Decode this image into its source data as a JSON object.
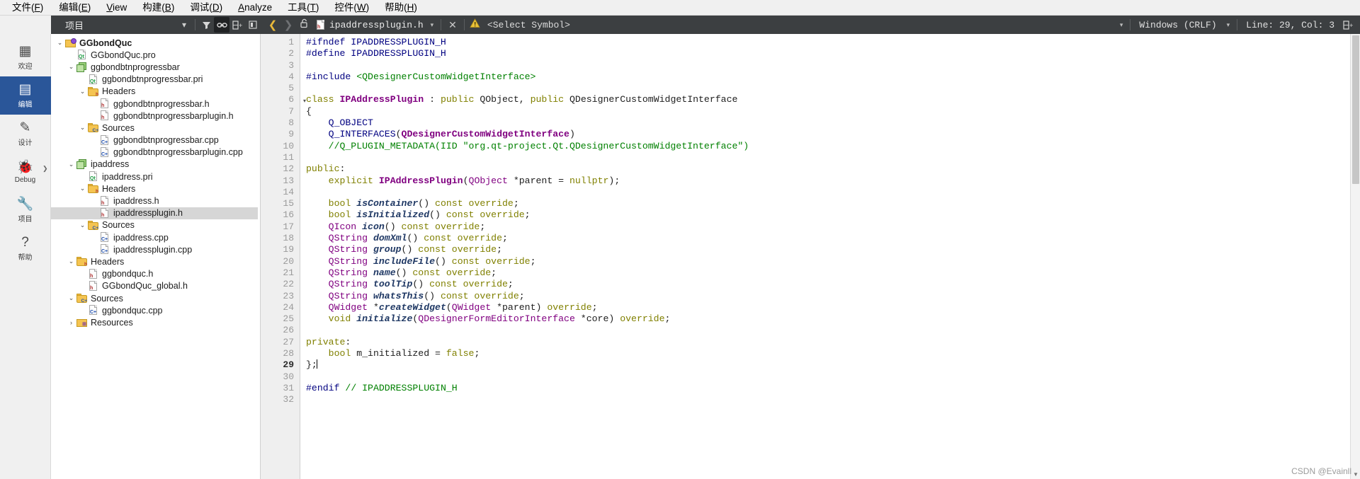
{
  "menubar": {
    "items": [
      {
        "label": "文件(F)",
        "mnemonic": "F"
      },
      {
        "label": "编辑(E)",
        "mnemonic": "E"
      },
      {
        "label": "View",
        "mnemonic": "V"
      },
      {
        "label": "构建(B)",
        "mnemonic": "B"
      },
      {
        "label": "调试(D)",
        "mnemonic": "D"
      },
      {
        "label": "Analyze",
        "mnemonic": "A"
      },
      {
        "label": "工具(T)",
        "mnemonic": "T"
      },
      {
        "label": "控件(W)",
        "mnemonic": "W"
      },
      {
        "label": "帮助(H)",
        "mnemonic": "H"
      }
    ]
  },
  "project_toolbar": {
    "mode_label": "项目",
    "dropdown_caret": "▾",
    "filter_icon": "filter-icon",
    "link_icon": "link-icon",
    "split_icon": "split-icon",
    "panel_icon": "panel-icon"
  },
  "editor_toolbar": {
    "back_arrow": "❮",
    "forward_arrow": "❯",
    "lock_icon": "unlocked-padlock-icon",
    "file_icon": "h-file-icon",
    "filename": "ipaddressplugin.h",
    "file_caret": "▾",
    "close_label": "✕",
    "warning_icon": "warning-triangle-icon",
    "symbol_selector": "<Select Symbol>",
    "symbol_caret": "▾",
    "line_ending": "Windows (CRLF)",
    "line_ending_caret": "▾",
    "cursor_position": "Line: 29, Col: 3",
    "split_icon": "split-editor-icon"
  },
  "activity_rail": {
    "items": [
      {
        "label": "欢迎",
        "icon": "grid-icon",
        "selected": false
      },
      {
        "label": "编辑",
        "icon": "document-icon",
        "selected": true
      },
      {
        "label": "设计",
        "icon": "pencil-icon",
        "selected": false
      },
      {
        "label": "Debug",
        "icon": "bug-icon",
        "selected": false
      },
      {
        "label": "项目",
        "icon": "wrench-icon",
        "selected": false
      },
      {
        "label": "帮助",
        "icon": "question-icon",
        "selected": false
      }
    ]
  },
  "project_tree": {
    "nodes": [
      {
        "label": "GGbondQuc",
        "indent": 0,
        "arrow": "v",
        "icon": "project-root-icon",
        "bold": true,
        "selected": false
      },
      {
        "label": "GGbondQuc.pro",
        "indent": 1,
        "arrow": "",
        "icon": "qt-pro-file-icon",
        "bold": false,
        "selected": false
      },
      {
        "label": "ggbondbtnprogressbar",
        "indent": 1,
        "arrow": "v",
        "icon": "subproject-icon",
        "bold": false,
        "selected": false
      },
      {
        "label": "ggbondbtnprogressbar.pri",
        "indent": 2,
        "arrow": "",
        "icon": "qt-pri-file-icon",
        "bold": false,
        "selected": false
      },
      {
        "label": "Headers",
        "indent": 2,
        "arrow": "v",
        "icon": "headers-folder-icon",
        "bold": false,
        "selected": false
      },
      {
        "label": "ggbondbtnprogressbar.h",
        "indent": 3,
        "arrow": "",
        "icon": "h-file-icon",
        "bold": false,
        "selected": false
      },
      {
        "label": "ggbondbtnprogressbarplugin.h",
        "indent": 3,
        "arrow": "",
        "icon": "h-file-icon",
        "bold": false,
        "selected": false
      },
      {
        "label": "Sources",
        "indent": 2,
        "arrow": "v",
        "icon": "sources-folder-icon",
        "bold": false,
        "selected": false
      },
      {
        "label": "ggbondbtnprogressbar.cpp",
        "indent": 3,
        "arrow": "",
        "icon": "cpp-file-icon",
        "bold": false,
        "selected": false
      },
      {
        "label": "ggbondbtnprogressbarplugin.cpp",
        "indent": 3,
        "arrow": "",
        "icon": "cpp-file-icon",
        "bold": false,
        "selected": false
      },
      {
        "label": "ipaddress",
        "indent": 1,
        "arrow": "v",
        "icon": "subproject-icon",
        "bold": false,
        "selected": false
      },
      {
        "label": "ipaddress.pri",
        "indent": 2,
        "arrow": "",
        "icon": "qt-pri-file-icon",
        "bold": false,
        "selected": false
      },
      {
        "label": "Headers",
        "indent": 2,
        "arrow": "v",
        "icon": "headers-folder-icon",
        "bold": false,
        "selected": false
      },
      {
        "label": "ipaddress.h",
        "indent": 3,
        "arrow": "",
        "icon": "h-file-icon",
        "bold": false,
        "selected": false
      },
      {
        "label": "ipaddressplugin.h",
        "indent": 3,
        "arrow": "",
        "icon": "h-file-icon",
        "bold": false,
        "selected": true
      },
      {
        "label": "Sources",
        "indent": 2,
        "arrow": "v",
        "icon": "sources-folder-icon",
        "bold": false,
        "selected": false
      },
      {
        "label": "ipaddress.cpp",
        "indent": 3,
        "arrow": "",
        "icon": "cpp-file-icon",
        "bold": false,
        "selected": false
      },
      {
        "label": "ipaddressplugin.cpp",
        "indent": 3,
        "arrow": "",
        "icon": "cpp-file-icon",
        "bold": false,
        "selected": false
      },
      {
        "label": "Headers",
        "indent": 1,
        "arrow": "v",
        "icon": "headers-folder-icon",
        "bold": false,
        "selected": false
      },
      {
        "label": "ggbondquc.h",
        "indent": 2,
        "arrow": "",
        "icon": "h-file-icon",
        "bold": false,
        "selected": false
      },
      {
        "label": "GGbondQuc_global.h",
        "indent": 2,
        "arrow": "",
        "icon": "h-file-icon",
        "bold": false,
        "selected": false
      },
      {
        "label": "Sources",
        "indent": 1,
        "arrow": "v",
        "icon": "sources-folder-icon",
        "bold": false,
        "selected": false
      },
      {
        "label": "ggbondquc.cpp",
        "indent": 2,
        "arrow": "",
        "icon": "cpp-file-icon",
        "bold": false,
        "selected": false
      },
      {
        "label": "Resources",
        "indent": 1,
        "arrow": ">",
        "icon": "resources-folder-icon",
        "bold": false,
        "selected": false
      }
    ]
  },
  "code": {
    "current_line": 29,
    "lines": [
      {
        "n": 1,
        "fold": false,
        "tokens": [
          {
            "t": "pre",
            "s": "#ifndef IPADDRESSPLUGIN_H"
          }
        ]
      },
      {
        "n": 2,
        "fold": false,
        "tokens": [
          {
            "t": "pre",
            "s": "#define IPADDRESSPLUGIN_H"
          }
        ]
      },
      {
        "n": 3,
        "fold": false,
        "tokens": []
      },
      {
        "n": 4,
        "fold": false,
        "tokens": [
          {
            "t": "pre",
            "s": "#include "
          },
          {
            "t": "str",
            "s": "<QDesignerCustomWidgetInterface>"
          }
        ]
      },
      {
        "n": 5,
        "fold": false,
        "tokens": []
      },
      {
        "n": 6,
        "fold": true,
        "tokens": [
          {
            "t": "kw",
            "s": "class "
          },
          {
            "t": "cls",
            "s": "IPAddressPlugin"
          },
          {
            "t": "pun",
            "s": " : "
          },
          {
            "t": "kw",
            "s": "public "
          },
          {
            "t": "plain",
            "s": "QObject"
          },
          {
            "t": "pun",
            "s": ", "
          },
          {
            "t": "kw",
            "s": "public "
          },
          {
            "t": "plain",
            "s": "QDesignerCustomWidgetInterface"
          }
        ]
      },
      {
        "n": 7,
        "fold": false,
        "tokens": [
          {
            "t": "pun",
            "s": "{"
          }
        ]
      },
      {
        "n": 8,
        "fold": false,
        "tokens": [
          {
            "t": "macro",
            "s": "    Q_OBJECT"
          }
        ]
      },
      {
        "n": 9,
        "fold": false,
        "tokens": [
          {
            "t": "macro",
            "s": "    Q_INTERFACES"
          },
          {
            "t": "pun",
            "s": "("
          },
          {
            "t": "cls",
            "s": "QDesignerCustomWidgetInterface"
          },
          {
            "t": "pun",
            "s": ")"
          }
        ]
      },
      {
        "n": 10,
        "fold": false,
        "tokens": [
          {
            "t": "cmt",
            "s": "    //Q_PLUGIN_METADATA(IID \"org.qt-project.Qt.QDesignerCustomWidgetInterface\")"
          }
        ]
      },
      {
        "n": 11,
        "fold": false,
        "tokens": []
      },
      {
        "n": 12,
        "fold": false,
        "tokens": [
          {
            "t": "kw",
            "s": "public"
          },
          {
            "t": "pun",
            "s": ":"
          }
        ]
      },
      {
        "n": 13,
        "fold": false,
        "tokens": [
          {
            "t": "kw",
            "s": "    explicit "
          },
          {
            "t": "cls",
            "s": "IPAddressPlugin"
          },
          {
            "t": "pun",
            "s": "("
          },
          {
            "t": "typ",
            "s": "QObject"
          },
          {
            "t": "pun",
            "s": " *"
          },
          {
            "t": "plain",
            "s": "parent"
          },
          {
            "t": "pun",
            "s": " = "
          },
          {
            "t": "kw",
            "s": "nullptr"
          },
          {
            "t": "pun",
            "s": ");"
          }
        ]
      },
      {
        "n": 14,
        "fold": false,
        "tokens": []
      },
      {
        "n": 15,
        "fold": false,
        "tokens": [
          {
            "t": "kw",
            "s": "    bool "
          },
          {
            "t": "fn",
            "s": "isContainer"
          },
          {
            "t": "pun",
            "s": "() "
          },
          {
            "t": "kw",
            "s": "const override"
          },
          {
            "t": "pun",
            "s": ";"
          }
        ]
      },
      {
        "n": 16,
        "fold": false,
        "tokens": [
          {
            "t": "kw",
            "s": "    bool "
          },
          {
            "t": "fn",
            "s": "isInitialized"
          },
          {
            "t": "pun",
            "s": "() "
          },
          {
            "t": "kw",
            "s": "const override"
          },
          {
            "t": "pun",
            "s": ";"
          }
        ]
      },
      {
        "n": 17,
        "fold": false,
        "tokens": [
          {
            "t": "typ",
            "s": "    QIcon "
          },
          {
            "t": "fn",
            "s": "icon"
          },
          {
            "t": "pun",
            "s": "() "
          },
          {
            "t": "kw",
            "s": "const override"
          },
          {
            "t": "pun",
            "s": ";"
          }
        ]
      },
      {
        "n": 18,
        "fold": false,
        "tokens": [
          {
            "t": "typ",
            "s": "    QString "
          },
          {
            "t": "fn",
            "s": "domXml"
          },
          {
            "t": "pun",
            "s": "() "
          },
          {
            "t": "kw",
            "s": "const override"
          },
          {
            "t": "pun",
            "s": ";"
          }
        ]
      },
      {
        "n": 19,
        "fold": false,
        "tokens": [
          {
            "t": "typ",
            "s": "    QString "
          },
          {
            "t": "fn",
            "s": "group"
          },
          {
            "t": "pun",
            "s": "() "
          },
          {
            "t": "kw",
            "s": "const override"
          },
          {
            "t": "pun",
            "s": ";"
          }
        ]
      },
      {
        "n": 20,
        "fold": false,
        "tokens": [
          {
            "t": "typ",
            "s": "    QString "
          },
          {
            "t": "fn",
            "s": "includeFile"
          },
          {
            "t": "pun",
            "s": "() "
          },
          {
            "t": "kw",
            "s": "const override"
          },
          {
            "t": "pun",
            "s": ";"
          }
        ]
      },
      {
        "n": 21,
        "fold": false,
        "tokens": [
          {
            "t": "typ",
            "s": "    QString "
          },
          {
            "t": "fn",
            "s": "name"
          },
          {
            "t": "pun",
            "s": "() "
          },
          {
            "t": "kw",
            "s": "const override"
          },
          {
            "t": "pun",
            "s": ";"
          }
        ]
      },
      {
        "n": 22,
        "fold": false,
        "tokens": [
          {
            "t": "typ",
            "s": "    QString "
          },
          {
            "t": "fn",
            "s": "toolTip"
          },
          {
            "t": "pun",
            "s": "() "
          },
          {
            "t": "kw",
            "s": "const override"
          },
          {
            "t": "pun",
            "s": ";"
          }
        ]
      },
      {
        "n": 23,
        "fold": false,
        "tokens": [
          {
            "t": "typ",
            "s": "    QString "
          },
          {
            "t": "fn",
            "s": "whatsThis"
          },
          {
            "t": "pun",
            "s": "() "
          },
          {
            "t": "kw",
            "s": "const override"
          },
          {
            "t": "pun",
            "s": ";"
          }
        ]
      },
      {
        "n": 24,
        "fold": false,
        "tokens": [
          {
            "t": "typ",
            "s": "    QWidget "
          },
          {
            "t": "pun",
            "s": "*"
          },
          {
            "t": "fn",
            "s": "createWidget"
          },
          {
            "t": "pun",
            "s": "("
          },
          {
            "t": "typ",
            "s": "QWidget"
          },
          {
            "t": "pun",
            "s": " *"
          },
          {
            "t": "plain",
            "s": "parent"
          },
          {
            "t": "pun",
            "s": ") "
          },
          {
            "t": "kw",
            "s": "override"
          },
          {
            "t": "pun",
            "s": ";"
          }
        ]
      },
      {
        "n": 25,
        "fold": false,
        "tokens": [
          {
            "t": "kw",
            "s": "    void "
          },
          {
            "t": "fn",
            "s": "initialize"
          },
          {
            "t": "pun",
            "s": "("
          },
          {
            "t": "typ",
            "s": "QDesignerFormEditorInterface"
          },
          {
            "t": "pun",
            "s": " *"
          },
          {
            "t": "plain",
            "s": "core"
          },
          {
            "t": "pun",
            "s": ") "
          },
          {
            "t": "kw",
            "s": "override"
          },
          {
            "t": "pun",
            "s": ";"
          }
        ]
      },
      {
        "n": 26,
        "fold": false,
        "tokens": []
      },
      {
        "n": 27,
        "fold": false,
        "tokens": [
          {
            "t": "kw",
            "s": "private"
          },
          {
            "t": "pun",
            "s": ":"
          }
        ]
      },
      {
        "n": 28,
        "fold": false,
        "tokens": [
          {
            "t": "kw",
            "s": "    bool "
          },
          {
            "t": "plain",
            "s": "m_initialized"
          },
          {
            "t": "pun",
            "s": " = "
          },
          {
            "t": "kw",
            "s": "false"
          },
          {
            "t": "pun",
            "s": ";"
          }
        ]
      },
      {
        "n": 29,
        "fold": false,
        "cursor": true,
        "tokens": [
          {
            "t": "pun",
            "s": "};"
          }
        ]
      },
      {
        "n": 30,
        "fold": false,
        "tokens": []
      },
      {
        "n": 31,
        "fold": false,
        "tokens": [
          {
            "t": "pre",
            "s": "#endif "
          },
          {
            "t": "cmt",
            "s": "// IPADDRESSPLUGIN_H"
          }
        ]
      },
      {
        "n": 32,
        "fold": false,
        "tokens": []
      }
    ]
  },
  "watermark": "CSDN @Evainll",
  "colors": {
    "menubar_bg": "#f0f0f0",
    "toolbar_bg": "#3c3f41",
    "selection_blue": "#2a5699",
    "tree_selected": "#d6d6d6",
    "gutter_bg": "#efefef",
    "keyword": "#808000",
    "type": "#800080",
    "function": "#1f3864",
    "comment": "#008000",
    "preprocessor": "#000080"
  }
}
